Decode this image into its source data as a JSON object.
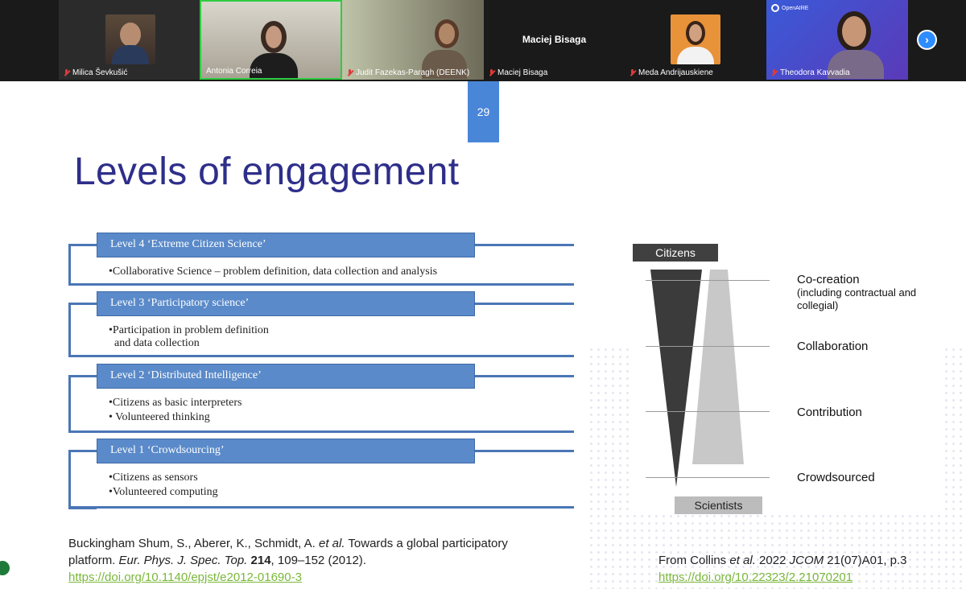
{
  "participants": [
    {
      "name": "Milica Ševkušić",
      "muted": true,
      "active": false
    },
    {
      "name": "Antonia Correia",
      "muted": false,
      "active": true
    },
    {
      "name": "Judit Fazekas-Paragh (DEENK)",
      "muted": true,
      "active": false
    },
    {
      "name": "Maciej Bisaga",
      "muted": true,
      "active": false,
      "header_name": "Maciej Bisaga"
    },
    {
      "name": "Meda Andrijauskiene",
      "muted": true,
      "active": false
    },
    {
      "name": "Theodora Kavvadia",
      "muted": true,
      "active": false,
      "logo_text": "OpenAIRE"
    }
  ],
  "slide": {
    "number": "29",
    "title": "Levels of engagement",
    "levels": [
      {
        "header": "Level 4 ‘Extreme Citizen Science’",
        "bullets": [
          "•Collaborative Science – problem definition, data collection and analysis"
        ]
      },
      {
        "header": "Level 3 ‘Participatory science’",
        "bullets": [
          "•Participation in problem definition",
          "  and data collection"
        ]
      },
      {
        "header": "Level 2 ‘Distributed Intelligence’",
        "bullets": [
          "•Citizens as basic interpreters",
          "• Volunteered thinking"
        ]
      },
      {
        "header": "Level 1 ‘Crowdsourcing’",
        "bullets": [
          "•Citizens as sensors",
          "•Volunteered computing"
        ]
      }
    ],
    "funnel": {
      "top_label": "Citizens",
      "bottom_label": "Scientists",
      "stages": [
        {
          "name": "Co-creation",
          "detail": "(including contractual  and collegial)"
        },
        {
          "name": "Collaboration",
          "detail": ""
        },
        {
          "name": "Contribution",
          "detail": ""
        },
        {
          "name": "Crowdsourced",
          "detail": ""
        }
      ]
    },
    "ref_left": {
      "line1_a": "Buckingham Shum, S., Aberer, K., Schmidt, A. ",
      "line1_etal": "et al.",
      "line1_b": " Towards a global participatory",
      "line2_a": "platform. ",
      "line2_journal": "Eur. Phys. J. Spec. Top.",
      "line2_vol": " 214",
      "line2_b": ", 109–152 (2012).",
      "link": "https://doi.org/10.1140/epjst/e2012-01690-3"
    },
    "ref_right": {
      "text_a": "From Collins ",
      "etal": "et al.",
      "text_b": " 2022 ",
      "journal": "JCOM",
      "text_c": " 21(07)A01, p.3",
      "link": "https://doi.org/10.22323/2.21070201"
    }
  },
  "colors": {
    "accent": "#4a86d8",
    "title": "#2e2e8a",
    "link": "#7ab83a",
    "active_border": "#2ecc40"
  }
}
